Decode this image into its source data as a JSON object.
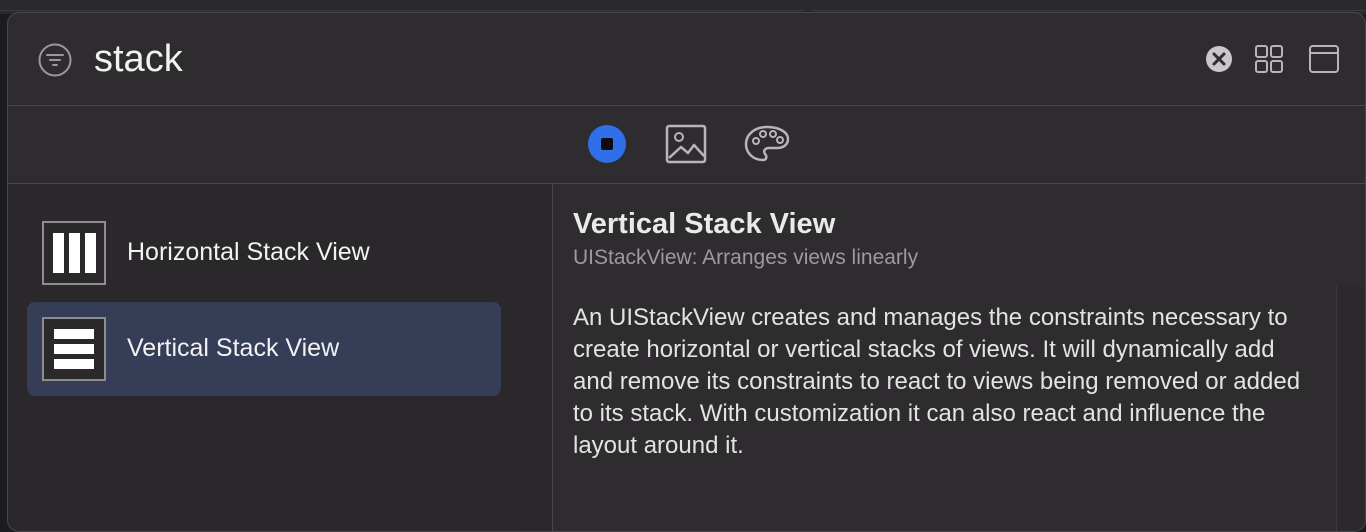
{
  "search": {
    "value": "stack",
    "filter_icon": "filter-icon",
    "clear_icon": "clear-icon",
    "grid_icon": "grid-view-icon",
    "window_icon": "window-layout-icon"
  },
  "segments": [
    {
      "name": "objects",
      "icon": "stop-square-icon",
      "selected": true,
      "accent": "#2f6fe8"
    },
    {
      "name": "media",
      "icon": "image-icon",
      "selected": false
    },
    {
      "name": "colors",
      "icon": "palette-icon",
      "selected": false
    }
  ],
  "list": {
    "items": [
      {
        "label": "Horizontal Stack View",
        "icon": "horizontal-stack-icon",
        "selected": false
      },
      {
        "label": "Vertical Stack View",
        "icon": "vertical-stack-icon",
        "selected": true
      }
    ],
    "selected_color": "#353d57"
  },
  "detail": {
    "title": "Vertical Stack View",
    "subtitle": "UIStackView: Arranges views linearly",
    "description": "An UIStackView creates and manages the constraints necessary to create horizontal or vertical stacks of views. It will dynamically add and remove its constraints to react to views being removed or added to its stack. With customization it can also react and influence the layout around it."
  }
}
